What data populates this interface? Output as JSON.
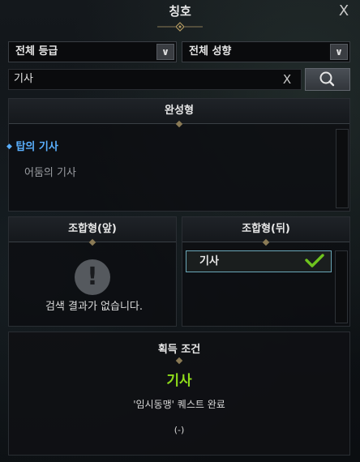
{
  "window": {
    "title": "칭호"
  },
  "filters": {
    "grade": "전체 등급",
    "tendency": "전체 성향"
  },
  "search": {
    "value": "기사"
  },
  "complete": {
    "header": "완성형",
    "items": [
      {
        "label": "탑의 기사",
        "selected": true
      },
      {
        "label": "어둠의 기사",
        "selected": false
      }
    ]
  },
  "front": {
    "header": "조합형(앞)",
    "empty_message": "검색 결과가 없습니다."
  },
  "back": {
    "header": "조합형(뒤)",
    "items": [
      {
        "label": "기사",
        "selected": true
      }
    ]
  },
  "acquire": {
    "header": "획득 조건",
    "title_name": "기사",
    "condition": "'임시동맹' 퀘스트 완료",
    "count": "(-)"
  },
  "colors": {
    "highlight": "#5ab0ff",
    "accent_green": "#8fdc1a",
    "selected_border": "#6aa7b8"
  }
}
